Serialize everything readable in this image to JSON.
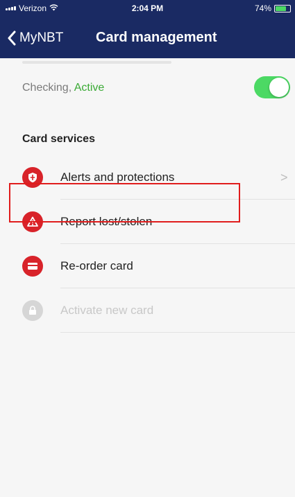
{
  "status_bar": {
    "carrier": "Verizon",
    "time": "2:04 PM",
    "battery": "74%",
    "battery_level": 0.74,
    "wifi_icon": "wifi-icon"
  },
  "navbar": {
    "back_label": "MyNBT",
    "title": "Card management"
  },
  "account": {
    "type": "Checking,",
    "status": "Active",
    "toggle_on": true
  },
  "card_services": {
    "header": "Card services",
    "items": [
      {
        "label": "Alerts and protections",
        "icon": "shield-icon",
        "chevron": ">"
      },
      {
        "label": "Report lost/stolen",
        "icon": "warning-icon"
      },
      {
        "label": "Re-order card",
        "icon": "card-icon"
      },
      {
        "label": "Activate new card",
        "icon": "lock-icon",
        "disabled": true
      }
    ]
  },
  "colors": {
    "nav_bg": "#1a2a63",
    "accent_red": "#d8232a",
    "active_green": "#3aaa35",
    "toggle_green": "#4cd964",
    "highlight": "#e01c1c"
  }
}
